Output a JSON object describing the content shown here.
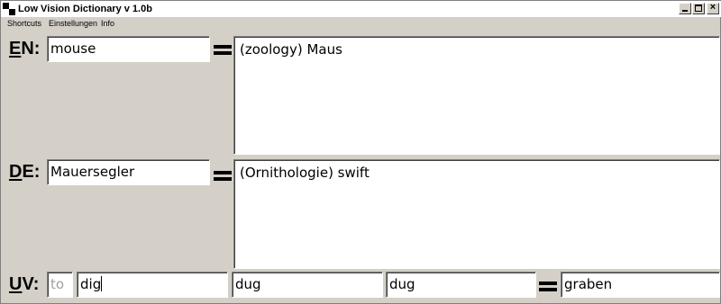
{
  "window": {
    "title": "Low Vision Dictionary v 1.0b",
    "controls": {
      "minimize": "minimize",
      "maximize": "maximize",
      "close": "×"
    }
  },
  "menu": {
    "items": [
      "Shortcuts",
      "Einstellungen",
      "Info"
    ]
  },
  "en": {
    "label_accel": "E",
    "label_rest": "N:",
    "input_value": "mouse",
    "equals": "=",
    "result": "(zoology) Maus"
  },
  "de": {
    "label_accel": "D",
    "label_rest": "E:",
    "input_value": "Mauersegler",
    "equals": "=",
    "result": "(Ornithologie) swift"
  },
  "uv": {
    "label_accel": "U",
    "label_rest": "V:",
    "prefix": "to",
    "infinitive": "dig",
    "past": "dug",
    "participle": "dug",
    "translation": "graben"
  },
  "colors": {
    "face": "#d4d0c8",
    "field": "#ffffff",
    "text": "#000000",
    "disabled_text": "#a0a0a0"
  },
  "icons": [
    "app-icon",
    "minimize-icon",
    "maximize-icon",
    "close-icon",
    "equals-icon"
  ]
}
